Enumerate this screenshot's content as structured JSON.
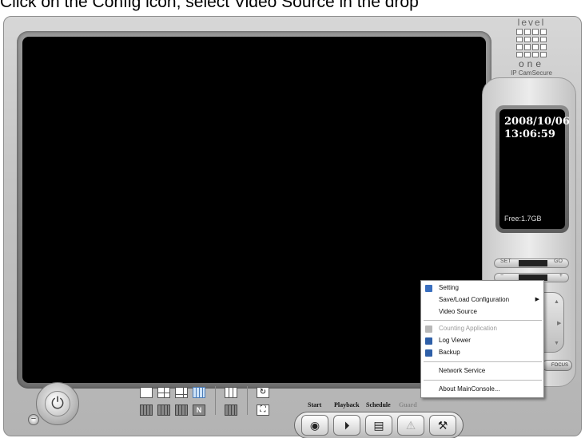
{
  "instruction": {
    "text": "Click on the Config icon, select Video Source in the drop"
  },
  "logo": {
    "top_text": "level",
    "bottom_text": "one",
    "brand": "IP CamSecure"
  },
  "display": {
    "date": "2008/10/06",
    "time": "13:06:59",
    "free": "Free:1.7GB",
    "set_label": "SET",
    "go_label": "GO",
    "focus_label": "FOCUS"
  },
  "toolbar": {
    "start_label": "Start",
    "playback_label": "Playback",
    "schedule_label": "Schedule",
    "guard_label": "Guard",
    "layout_n_label": "N"
  },
  "context_menu": {
    "items": [
      {
        "label": "Setting",
        "icon": "setting-icon",
        "enabled": true
      },
      {
        "label": "Save/Load Configuration",
        "icon": "",
        "enabled": true,
        "submenu": true
      },
      {
        "label": "Video Source",
        "icon": "",
        "enabled": true
      },
      {
        "label": "Counting Application",
        "icon": "counting-icon",
        "enabled": false
      },
      {
        "label": "Log Viewer",
        "icon": "log-viewer-icon",
        "enabled": true
      },
      {
        "label": "Backup",
        "icon": "backup-icon",
        "enabled": true
      },
      {
        "label": "Network Service",
        "icon": "",
        "enabled": true
      },
      {
        "label": "About MainConsole...",
        "icon": "",
        "enabled": true
      }
    ]
  },
  "colors": {
    "video_bg": "#000000",
    "menu_bg": "#ffffff",
    "chassis": "#c4c4c4",
    "layout_active": "#4a7bb7"
  }
}
